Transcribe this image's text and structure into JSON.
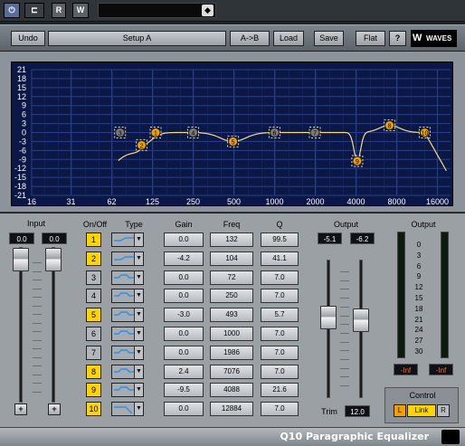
{
  "host": {
    "power_label": "⏻",
    "bypass_label": "⊏",
    "read_label": "R",
    "write_label": "W",
    "preset_value": "",
    "preset_arrow_icon": "diamond-arrow-icon"
  },
  "toolbar": {
    "undo": "Undo",
    "setup": "Setup A",
    "ab": "A->B",
    "load": "Load",
    "save": "Save",
    "flat": "Flat",
    "help": "?",
    "logo": "WAVES"
  },
  "graph": {
    "y_ticks": [
      "21",
      "18",
      "15",
      "12",
      "9",
      "6",
      "3",
      "0",
      "-3",
      "-6",
      "-9",
      "-12",
      "-15",
      "-18",
      "-21"
    ],
    "x_ticks": [
      "16",
      "31",
      "62",
      "125",
      "250",
      "500",
      "1000",
      "2000",
      "4000",
      "8000",
      "16000"
    ],
    "nodes": [
      {
        "label": "1",
        "active": true
      },
      {
        "label": "2",
        "active": true
      },
      {
        "label": "3",
        "active": false
      },
      {
        "label": "4",
        "active": false
      },
      {
        "label": "5",
        "active": true
      },
      {
        "label": "6",
        "active": false
      },
      {
        "label": "7",
        "active": false
      },
      {
        "label": "8",
        "active": true
      },
      {
        "label": "9",
        "active": true
      },
      {
        "label": "10",
        "active": true
      }
    ],
    "colors": {
      "background": "#0b1845",
      "grid": "#2a3f8a",
      "curve": "#f2dc8a",
      "node_active": "#f0a000",
      "node_inactive": "#7a7a7a"
    }
  },
  "input": {
    "label": "Input",
    "left": "0.0",
    "right": "0.0",
    "plus_left": "+",
    "plus_right": "+"
  },
  "table_headers": {
    "onoff": "On/Off",
    "type": "Type",
    "gain": "Gain",
    "freq": "Freq",
    "q": "Q"
  },
  "bands": [
    {
      "num": "1",
      "on": true,
      "type": "low-shelf",
      "gain": "0.0",
      "freq": "132",
      "q": "99.5"
    },
    {
      "num": "2",
      "on": true,
      "type": "low-shelf",
      "gain": "-4.2",
      "freq": "104",
      "q": "41.1"
    },
    {
      "num": "3",
      "on": false,
      "type": "bell",
      "gain": "0.0",
      "freq": "72",
      "q": "7.0"
    },
    {
      "num": "4",
      "on": false,
      "type": "bell",
      "gain": "0.0",
      "freq": "250",
      "q": "7.0"
    },
    {
      "num": "5",
      "on": true,
      "type": "bell",
      "gain": "-3.0",
      "freq": "493",
      "q": "5.7"
    },
    {
      "num": "6",
      "on": false,
      "type": "bell",
      "gain": "0.0",
      "freq": "1000",
      "q": "7.0"
    },
    {
      "num": "7",
      "on": false,
      "type": "bell",
      "gain": "0.0",
      "freq": "1986",
      "q": "7.0"
    },
    {
      "num": "8",
      "on": true,
      "type": "bell",
      "gain": "2.4",
      "freq": "7076",
      "q": "7.0"
    },
    {
      "num": "9",
      "on": true,
      "type": "bell",
      "gain": "-9.5",
      "freq": "4088",
      "q": "21.6"
    },
    {
      "num": "10",
      "on": true,
      "type": "high-cut",
      "gain": "0.0",
      "freq": "12884",
      "q": "7.0"
    }
  ],
  "output": {
    "label": "Output",
    "left": "-5.1",
    "right": "-6.2",
    "trim_label": "Trim",
    "trim_value": "12.0"
  },
  "meter": {
    "label": "Output",
    "scale": [
      "0",
      "3",
      "6",
      "9",
      "12",
      "15",
      "18",
      "21",
      "24",
      "27",
      "30"
    ],
    "peak_left": "-Inf",
    "peak_right": "-Inf"
  },
  "control": {
    "label": "Control",
    "l": "L",
    "link": "Link",
    "r": "R"
  },
  "footer": {
    "title": "Q10 Paragraphic Equalizer"
  }
}
